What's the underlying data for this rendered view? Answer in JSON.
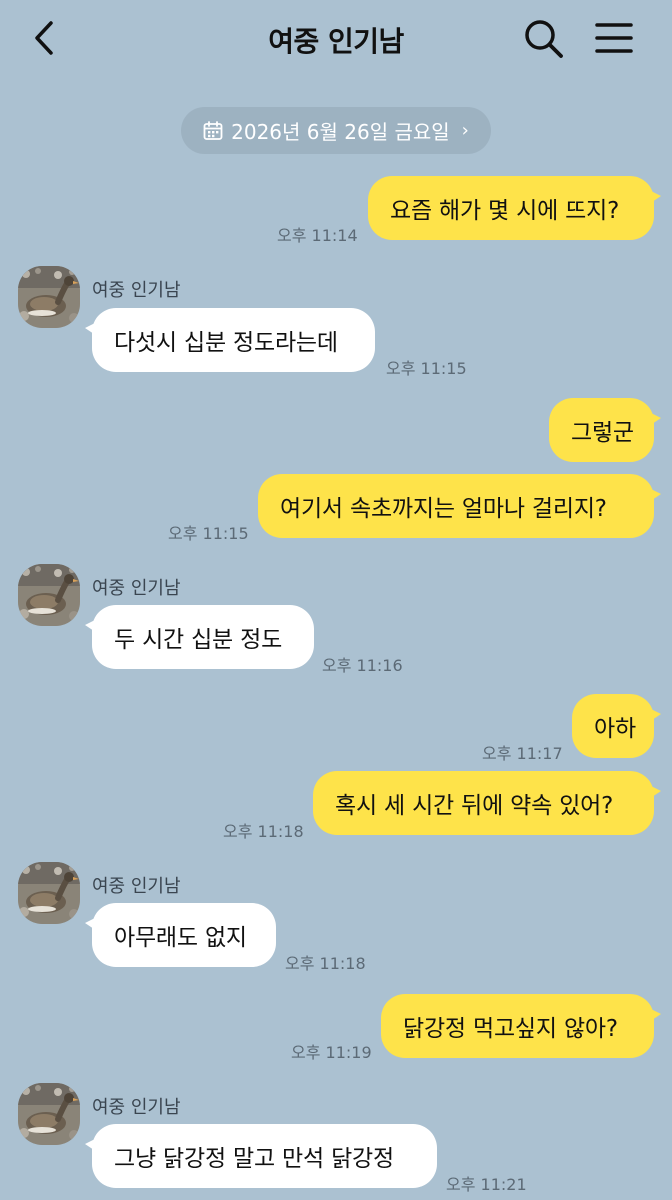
{
  "header": {
    "title": "여중 인기남"
  },
  "date_divider": "2026년 6월 26일 금요일",
  "messages": [
    {
      "from": "me",
      "text": "요즘 해가 몇 시에 뜨지?",
      "time": "오후 11:14"
    },
    {
      "from": "them",
      "sender": "여중 인기남",
      "text": "다섯시 십분 정도라는데",
      "time": "오후 11:15"
    },
    {
      "from": "me",
      "text": "그렇군"
    },
    {
      "from": "me",
      "text": "여기서 속초까지는 얼마나 걸리지?",
      "time": "오후 11:15"
    },
    {
      "from": "them",
      "sender": "여중 인기남",
      "text": "두 시간 십분 정도",
      "time": "오후 11:16"
    },
    {
      "from": "me",
      "text": "아하",
      "time": "오후 11:17"
    },
    {
      "from": "me",
      "text": "혹시 세 시간 뒤에 약속 있어?",
      "time": "오후 11:18"
    },
    {
      "from": "them",
      "sender": "여중 인기남",
      "text": "아무래도 없지",
      "time": "오후 11:18"
    },
    {
      "from": "me",
      "text": "닭강정 먹고싶지 않아?",
      "time": "오후 11:19"
    },
    {
      "from": "them",
      "sender": "여중 인기남",
      "text": "그냥 닭강정 말고 만석 닭강정",
      "time": "오후 11:21"
    }
  ],
  "colors": {
    "background": "#abc1d1",
    "my_bubble": "#fee34a",
    "their_bubble": "#ffffff"
  },
  "icons": {
    "back": "chevron-left-icon",
    "search": "search-icon",
    "menu": "hamburger-menu-icon",
    "calendar": "calendar-icon",
    "avatar": "goose-avatar"
  }
}
